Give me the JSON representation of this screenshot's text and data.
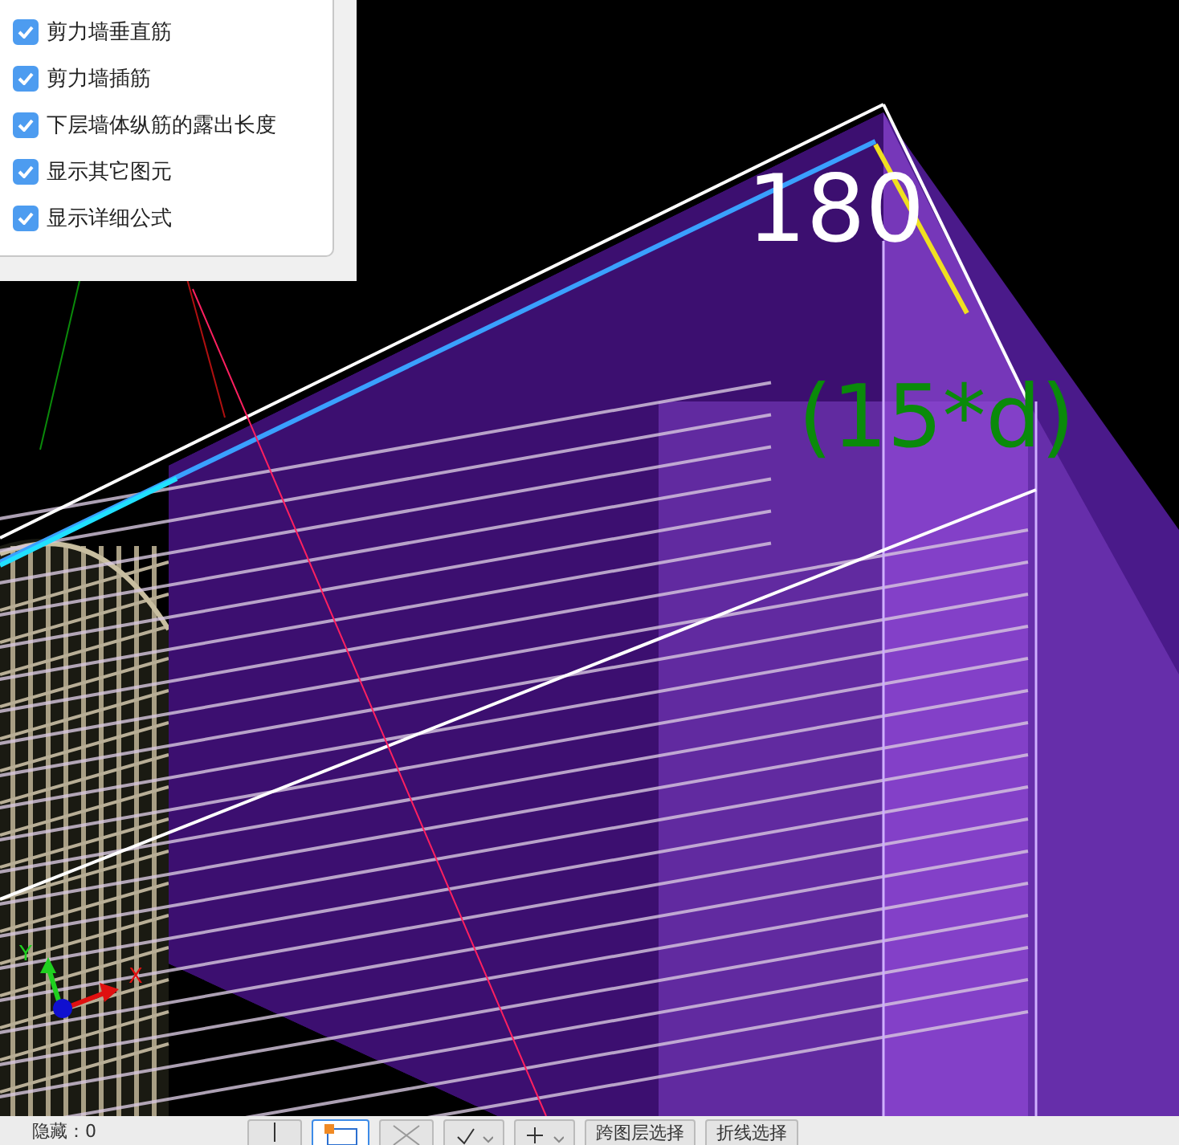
{
  "options_panel": {
    "items": [
      {
        "label": "剪力墙垂直筋",
        "checked": true
      },
      {
        "label": "剪力墙插筋",
        "checked": true
      },
      {
        "label": "下层墙体纵筋的露出长度",
        "checked": true
      },
      {
        "label": "显示其它图元",
        "checked": true
      },
      {
        "label": "显示详细公式",
        "checked": true
      }
    ]
  },
  "viewport": {
    "dimension_value": "180",
    "dimension_formula": "(15*d)",
    "axis_y_label": "Y",
    "axis_x_label": "X"
  },
  "toolbar": {
    "hidden_count": "隐藏：0",
    "buttons": [
      {
        "kind": "line",
        "selected": false
      },
      {
        "kind": "rect",
        "selected": true
      },
      {
        "kind": "cross",
        "selected": false
      },
      {
        "kind": "check",
        "selected": false
      },
      {
        "kind": "plus",
        "selected": false
      },
      {
        "kind": "text",
        "label": "跨图层选择",
        "selected": false
      },
      {
        "kind": "text",
        "label": "折线选择",
        "selected": false
      }
    ]
  }
}
